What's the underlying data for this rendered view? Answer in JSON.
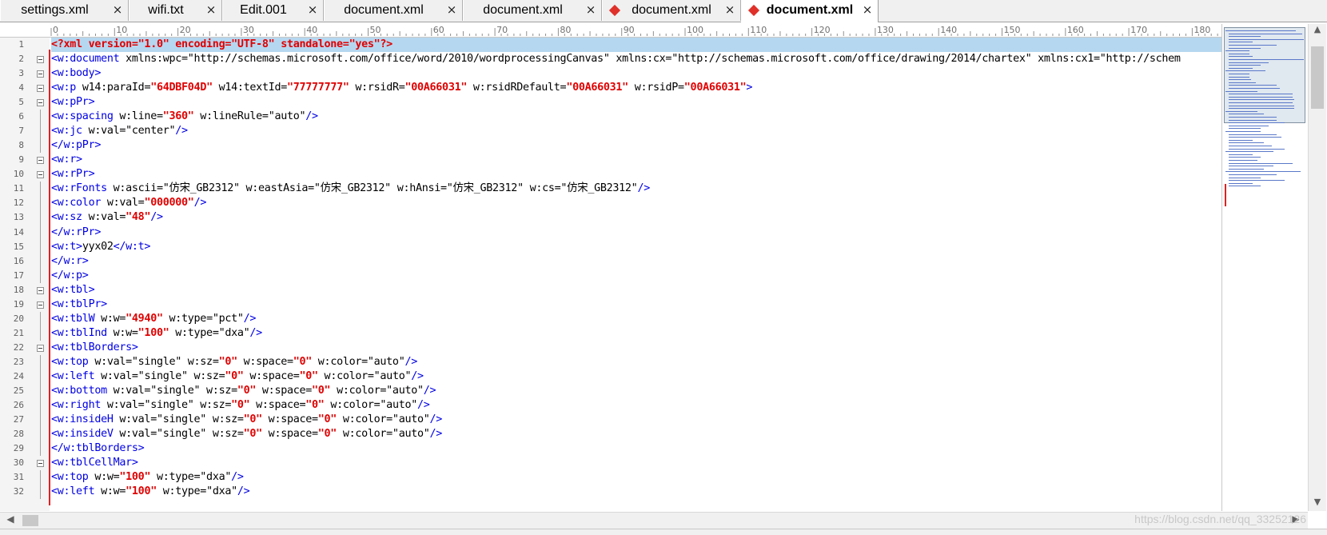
{
  "tabs": [
    {
      "label": "settings.xml",
      "close": "×",
      "active": false,
      "modified": false
    },
    {
      "label": "wifi.txt",
      "close": "×",
      "active": false,
      "modified": false
    },
    {
      "label": "Edit.001",
      "close": "×",
      "active": false,
      "modified": false
    },
    {
      "label": "document.xml",
      "close": "×",
      "active": false,
      "modified": false
    },
    {
      "label": "document.xml",
      "close": "×",
      "active": false,
      "modified": false
    },
    {
      "label": "document.xml",
      "close": "×",
      "active": false,
      "modified": true
    },
    {
      "label": "document.xml",
      "close": "×",
      "active": true,
      "modified": true
    }
  ],
  "ruler": {
    "labels": [
      "0",
      "10",
      "20",
      "30",
      "40",
      "50",
      "60",
      "70",
      "80",
      "90",
      "100",
      "110",
      "120",
      "130",
      "140",
      "150",
      "160",
      "170",
      "180"
    ]
  },
  "icons": {
    "modified": "diamond-modified-icon",
    "close": "close-icon",
    "fold": "fold-minus-icon"
  },
  "colors": {
    "tag": "#0000e6",
    "numeric_value": "#e00000",
    "highlight": "#b6d7f0",
    "change_bar": "#e02020"
  },
  "editor": {
    "lines": [
      {
        "num": "1",
        "fold": false,
        "highlight": true,
        "tokens": [
          [
            "pi",
            "<?xml version=\"1.0\" encoding=\"UTF-8\" standalone=\"yes\"?>"
          ]
        ]
      },
      {
        "num": "2",
        "fold": true,
        "tokens": [
          [
            "tg",
            "<w:document"
          ],
          [
            "at",
            " xmlns:wpc=\"http://schemas.microsoft.com/office/word/2010/wordprocessingCanvas\" xmlns:cx=\"http://schemas.microsoft.com/office/drawing/2014/chartex\" xmlns:cx1=\"http://schem"
          ]
        ]
      },
      {
        "num": "3",
        "fold": true,
        "tokens": [
          [
            "tg",
            "<w:body>"
          ]
        ]
      },
      {
        "num": "4",
        "fold": true,
        "tokens": [
          [
            "tg",
            "<w:p"
          ],
          [
            "at",
            " w14:paraId="
          ],
          [
            "nv",
            "\"64DBF04D\""
          ],
          [
            "at",
            " w14:textId="
          ],
          [
            "nv",
            "\"77777777\""
          ],
          [
            "at",
            " w:rsidR="
          ],
          [
            "nv",
            "\"00A66031\""
          ],
          [
            "at",
            " w:rsidRDefault="
          ],
          [
            "nv",
            "\"00A66031\""
          ],
          [
            "at",
            " w:rsidP="
          ],
          [
            "nv",
            "\"00A66031\""
          ],
          [
            "tg",
            ">"
          ]
        ]
      },
      {
        "num": "5",
        "fold": true,
        "tokens": [
          [
            "tg",
            "<w:pPr>"
          ]
        ]
      },
      {
        "num": "6",
        "fold": false,
        "tokens": [
          [
            "tg",
            "<w:spacing"
          ],
          [
            "at",
            " w:line="
          ],
          [
            "nv",
            "\"360\""
          ],
          [
            "at",
            " w:lineRule=\"auto\""
          ],
          [
            "tg",
            "/>"
          ]
        ]
      },
      {
        "num": "7",
        "fold": false,
        "tokens": [
          [
            "tg",
            "<w:jc"
          ],
          [
            "at",
            " w:val=\"center\""
          ],
          [
            "tg",
            "/>"
          ]
        ]
      },
      {
        "num": "8",
        "fold": false,
        "tokens": [
          [
            "tg",
            "</w:pPr>"
          ]
        ]
      },
      {
        "num": "9",
        "fold": true,
        "tokens": [
          [
            "tg",
            "<w:r>"
          ]
        ]
      },
      {
        "num": "10",
        "fold": true,
        "tokens": [
          [
            "tg",
            "<w:rPr>"
          ]
        ]
      },
      {
        "num": "11",
        "fold": false,
        "tokens": [
          [
            "tg",
            "<w:rFonts"
          ],
          [
            "at",
            " w:ascii=\"仿宋_GB2312\" w:eastAsia=\"仿宋_GB2312\" w:hAnsi=\"仿宋_GB2312\" w:cs=\"仿宋_GB2312\""
          ],
          [
            "tg",
            "/>"
          ]
        ]
      },
      {
        "num": "12",
        "fold": false,
        "tokens": [
          [
            "tg",
            "<w:color"
          ],
          [
            "at",
            " w:val="
          ],
          [
            "nv",
            "\"000000\""
          ],
          [
            "tg",
            "/>"
          ]
        ]
      },
      {
        "num": "13",
        "fold": false,
        "tokens": [
          [
            "tg",
            "<w:sz"
          ],
          [
            "at",
            " w:val="
          ],
          [
            "nv",
            "\"48\""
          ],
          [
            "tg",
            "/>"
          ]
        ]
      },
      {
        "num": "14",
        "fold": false,
        "tokens": [
          [
            "tg",
            "</w:rPr>"
          ]
        ]
      },
      {
        "num": "15",
        "fold": false,
        "tokens": [
          [
            "tg",
            "<w:t>"
          ],
          [
            "txt",
            "yyx02"
          ],
          [
            "tg",
            "</w:t>"
          ]
        ]
      },
      {
        "num": "16",
        "fold": false,
        "tokens": [
          [
            "tg",
            "</w:r>"
          ]
        ]
      },
      {
        "num": "17",
        "fold": false,
        "tokens": [
          [
            "tg",
            "</w:p>"
          ]
        ]
      },
      {
        "num": "18",
        "fold": true,
        "tokens": [
          [
            "tg",
            "<w:tbl>"
          ]
        ]
      },
      {
        "num": "19",
        "fold": true,
        "tokens": [
          [
            "tg",
            "<w:tblPr>"
          ]
        ]
      },
      {
        "num": "20",
        "fold": false,
        "tokens": [
          [
            "tg",
            "<w:tblW"
          ],
          [
            "at",
            " w:w="
          ],
          [
            "nv",
            "\"4940\""
          ],
          [
            "at",
            " w:type=\"pct\""
          ],
          [
            "tg",
            "/>"
          ]
        ]
      },
      {
        "num": "21",
        "fold": false,
        "tokens": [
          [
            "tg",
            "<w:tblInd"
          ],
          [
            "at",
            " w:w="
          ],
          [
            "nv",
            "\"100\""
          ],
          [
            "at",
            " w:type=\"dxa\""
          ],
          [
            "tg",
            "/>"
          ]
        ]
      },
      {
        "num": "22",
        "fold": true,
        "tokens": [
          [
            "tg",
            "<w:tblBorders>"
          ]
        ]
      },
      {
        "num": "23",
        "fold": false,
        "tokens": [
          [
            "tg",
            "<w:top"
          ],
          [
            "at",
            " w:val=\"single\" w:sz="
          ],
          [
            "nv",
            "\"0\""
          ],
          [
            "at",
            " w:space="
          ],
          [
            "nv",
            "\"0\""
          ],
          [
            "at",
            " w:color=\"auto\""
          ],
          [
            "tg",
            "/>"
          ]
        ]
      },
      {
        "num": "24",
        "fold": false,
        "tokens": [
          [
            "tg",
            "<w:left"
          ],
          [
            "at",
            " w:val=\"single\" w:sz="
          ],
          [
            "nv",
            "\"0\""
          ],
          [
            "at",
            " w:space="
          ],
          [
            "nv",
            "\"0\""
          ],
          [
            "at",
            " w:color=\"auto\""
          ],
          [
            "tg",
            "/>"
          ]
        ]
      },
      {
        "num": "25",
        "fold": false,
        "tokens": [
          [
            "tg",
            "<w:bottom"
          ],
          [
            "at",
            " w:val=\"single\" w:sz="
          ],
          [
            "nv",
            "\"0\""
          ],
          [
            "at",
            " w:space="
          ],
          [
            "nv",
            "\"0\""
          ],
          [
            "at",
            " w:color=\"auto\""
          ],
          [
            "tg",
            "/>"
          ]
        ]
      },
      {
        "num": "26",
        "fold": false,
        "tokens": [
          [
            "tg",
            "<w:right"
          ],
          [
            "at",
            " w:val=\"single\" w:sz="
          ],
          [
            "nv",
            "\"0\""
          ],
          [
            "at",
            " w:space="
          ],
          [
            "nv",
            "\"0\""
          ],
          [
            "at",
            " w:color=\"auto\""
          ],
          [
            "tg",
            "/>"
          ]
        ]
      },
      {
        "num": "27",
        "fold": false,
        "tokens": [
          [
            "tg",
            "<w:insideH"
          ],
          [
            "at",
            " w:val=\"single\" w:sz="
          ],
          [
            "nv",
            "\"0\""
          ],
          [
            "at",
            " w:space="
          ],
          [
            "nv",
            "\"0\""
          ],
          [
            "at",
            " w:color=\"auto\""
          ],
          [
            "tg",
            "/>"
          ]
        ]
      },
      {
        "num": "28",
        "fold": false,
        "tokens": [
          [
            "tg",
            "<w:insideV"
          ],
          [
            "at",
            " w:val=\"single\" w:sz="
          ],
          [
            "nv",
            "\"0\""
          ],
          [
            "at",
            " w:space="
          ],
          [
            "nv",
            "\"0\""
          ],
          [
            "at",
            " w:color=\"auto\""
          ],
          [
            "tg",
            "/>"
          ]
        ]
      },
      {
        "num": "29",
        "fold": false,
        "tokens": [
          [
            "tg",
            "</w:tblBorders>"
          ]
        ]
      },
      {
        "num": "30",
        "fold": true,
        "tokens": [
          [
            "tg",
            "<w:tblCellMar>"
          ]
        ]
      },
      {
        "num": "31",
        "fold": false,
        "tokens": [
          [
            "tg",
            "<w:top"
          ],
          [
            "at",
            " w:w="
          ],
          [
            "nv",
            "\"100\""
          ],
          [
            "at",
            " w:type=\"dxa\""
          ],
          [
            "tg",
            "/>"
          ]
        ]
      },
      {
        "num": "32",
        "fold": false,
        "tokens": [
          [
            "tg",
            "<w:left"
          ],
          [
            "at",
            " w:w="
          ],
          [
            "nv",
            "\"100\""
          ],
          [
            "at",
            " w:type=\"dxa\""
          ],
          [
            "tg",
            "/>"
          ]
        ]
      }
    ]
  },
  "scrollbars": {
    "up": "▲",
    "down": "▼",
    "left": "◀",
    "right": "▶"
  },
  "watermark": "https://blog.csdn.net/qq_33252126"
}
